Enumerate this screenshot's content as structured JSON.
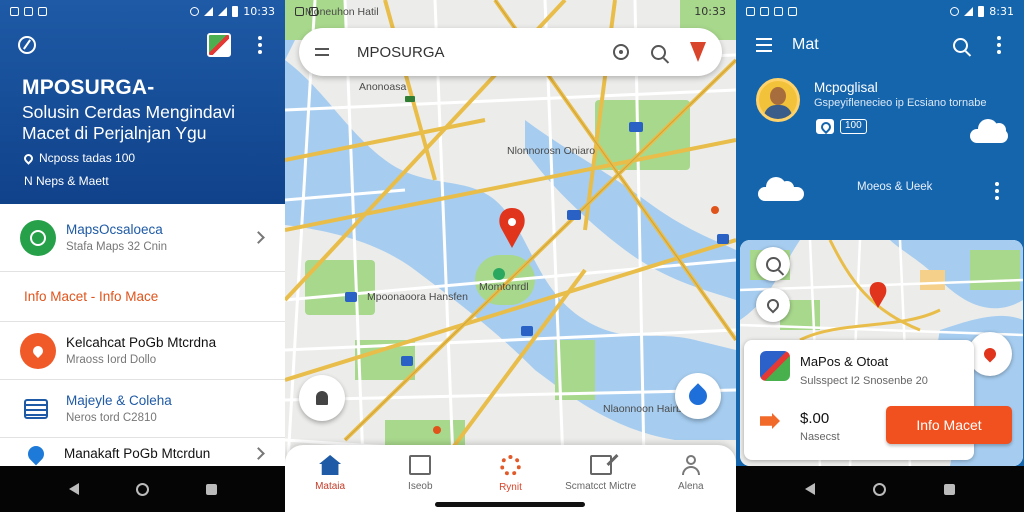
{
  "screen1": {
    "status": {
      "time": "10:33"
    },
    "title": "MPOSURGA-",
    "subtitle": "Solusin Cerdas Mengindavi Macet di Perjalnjan Ygu",
    "meta_location": "Ncposs tadas 100",
    "meta_line": "N Neps & Maett",
    "items": [
      {
        "title": "MapsOcsaloeca",
        "sub": "Stafa Maps 32 Cnin"
      }
    ],
    "section_title": "Info Macet - Info Mace",
    "items2": [
      {
        "title": "Kelcahcat PoGb Mtcrdna",
        "sub": "Mraoss Iord Dollo"
      },
      {
        "title": "Majeyle & Coleha",
        "sub": "Neros tord C2810"
      },
      {
        "title": "Manakaft PoGb Mtcrdun",
        "sub": ""
      }
    ]
  },
  "screen2": {
    "status": {
      "time": "10:33"
    },
    "search_query": "MPOSURGA",
    "map_labels": [
      "Moneuhon Hatil",
      "Nlonnorosn Oniaro",
      "Momtonrdl",
      "Anonoasa",
      "Mpoonaoora Hansfen",
      "Nlaonnoon Hairbroy"
    ],
    "nav": [
      {
        "label": "Mataia",
        "icon": "home-icon"
      },
      {
        "label": "Iseob",
        "icon": "book-icon"
      },
      {
        "label": "Rynit",
        "icon": "gear-icon"
      },
      {
        "label": "Scmatcct Mictre",
        "icon": "edit-icon"
      },
      {
        "label": "Alena",
        "icon": "person-icon"
      }
    ]
  },
  "screen3": {
    "status": {
      "time": "8:31"
    },
    "appbar_title": "Mat",
    "user_name": "Mcpoglisal",
    "user_sub": "Gspeyiflenecieo ip Ecsiano tornabe",
    "badge_count": "100",
    "follow_text": "Moeos & Ueek",
    "card": {
      "name": "MaPos & Otoat",
      "desc": "Sulsspect I2 Snosenbe 20",
      "price": "$.00",
      "price_label": "Nasecst",
      "button": "Info Macet"
    }
  },
  "colors": {
    "primary_blue": "#1e5aa6",
    "accent_orange": "#f0511e",
    "map_water": "#a6cdf0",
    "map_park": "#a8d88c",
    "map_road": "#e9bd4a"
  }
}
